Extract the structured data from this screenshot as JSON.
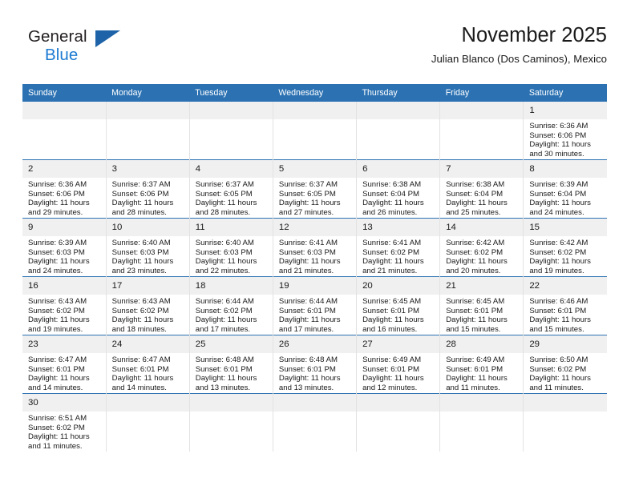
{
  "brand": {
    "word1": "General",
    "word2": "Blue",
    "flag_icon": "triangle-flag-icon",
    "accent_color": "#1e63a8",
    "blue_text_color": "#1b7ad1"
  },
  "header": {
    "month_title": "November 2025",
    "location": "Julian Blanco (Dos Caminos), Mexico"
  },
  "theme": {
    "header_row_bg": "#2c72b3",
    "daynum_bg": "#f0f0f0",
    "cell_bg": "#ffffff",
    "grid_line": "#e2e2e2"
  },
  "calendar": {
    "weekday_headers": [
      "Sunday",
      "Monday",
      "Tuesday",
      "Wednesday",
      "Thursday",
      "Friday",
      "Saturday"
    ],
    "labels": {
      "sunrise": "Sunrise:",
      "sunset": "Sunset:",
      "daylight": "Daylight:"
    },
    "weeks": [
      [
        {
          "day": "",
          "blank": true
        },
        {
          "day": "",
          "blank": true
        },
        {
          "day": "",
          "blank": true
        },
        {
          "day": "",
          "blank": true
        },
        {
          "day": "",
          "blank": true
        },
        {
          "day": "",
          "blank": true
        },
        {
          "day": "1",
          "sunrise": "Sunrise: 6:36 AM",
          "sunset": "Sunset: 6:06 PM",
          "daylight1": "Daylight: 11 hours",
          "daylight2": "and 30 minutes."
        }
      ],
      [
        {
          "day": "2",
          "sunrise": "Sunrise: 6:36 AM",
          "sunset": "Sunset: 6:06 PM",
          "daylight1": "Daylight: 11 hours",
          "daylight2": "and 29 minutes."
        },
        {
          "day": "3",
          "sunrise": "Sunrise: 6:37 AM",
          "sunset": "Sunset: 6:06 PM",
          "daylight1": "Daylight: 11 hours",
          "daylight2": "and 28 minutes."
        },
        {
          "day": "4",
          "sunrise": "Sunrise: 6:37 AM",
          "sunset": "Sunset: 6:05 PM",
          "daylight1": "Daylight: 11 hours",
          "daylight2": "and 28 minutes."
        },
        {
          "day": "5",
          "sunrise": "Sunrise: 6:37 AM",
          "sunset": "Sunset: 6:05 PM",
          "daylight1": "Daylight: 11 hours",
          "daylight2": "and 27 minutes."
        },
        {
          "day": "6",
          "sunrise": "Sunrise: 6:38 AM",
          "sunset": "Sunset: 6:04 PM",
          "daylight1": "Daylight: 11 hours",
          "daylight2": "and 26 minutes."
        },
        {
          "day": "7",
          "sunrise": "Sunrise: 6:38 AM",
          "sunset": "Sunset: 6:04 PM",
          "daylight1": "Daylight: 11 hours",
          "daylight2": "and 25 minutes."
        },
        {
          "day": "8",
          "sunrise": "Sunrise: 6:39 AM",
          "sunset": "Sunset: 6:04 PM",
          "daylight1": "Daylight: 11 hours",
          "daylight2": "and 24 minutes."
        }
      ],
      [
        {
          "day": "9",
          "sunrise": "Sunrise: 6:39 AM",
          "sunset": "Sunset: 6:03 PM",
          "daylight1": "Daylight: 11 hours",
          "daylight2": "and 24 minutes."
        },
        {
          "day": "10",
          "sunrise": "Sunrise: 6:40 AM",
          "sunset": "Sunset: 6:03 PM",
          "daylight1": "Daylight: 11 hours",
          "daylight2": "and 23 minutes."
        },
        {
          "day": "11",
          "sunrise": "Sunrise: 6:40 AM",
          "sunset": "Sunset: 6:03 PM",
          "daylight1": "Daylight: 11 hours",
          "daylight2": "and 22 minutes."
        },
        {
          "day": "12",
          "sunrise": "Sunrise: 6:41 AM",
          "sunset": "Sunset: 6:03 PM",
          "daylight1": "Daylight: 11 hours",
          "daylight2": "and 21 minutes."
        },
        {
          "day": "13",
          "sunrise": "Sunrise: 6:41 AM",
          "sunset": "Sunset: 6:02 PM",
          "daylight1": "Daylight: 11 hours",
          "daylight2": "and 21 minutes."
        },
        {
          "day": "14",
          "sunrise": "Sunrise: 6:42 AM",
          "sunset": "Sunset: 6:02 PM",
          "daylight1": "Daylight: 11 hours",
          "daylight2": "and 20 minutes."
        },
        {
          "day": "15",
          "sunrise": "Sunrise: 6:42 AM",
          "sunset": "Sunset: 6:02 PM",
          "daylight1": "Daylight: 11 hours",
          "daylight2": "and 19 minutes."
        }
      ],
      [
        {
          "day": "16",
          "sunrise": "Sunrise: 6:43 AM",
          "sunset": "Sunset: 6:02 PM",
          "daylight1": "Daylight: 11 hours",
          "daylight2": "and 19 minutes."
        },
        {
          "day": "17",
          "sunrise": "Sunrise: 6:43 AM",
          "sunset": "Sunset: 6:02 PM",
          "daylight1": "Daylight: 11 hours",
          "daylight2": "and 18 minutes."
        },
        {
          "day": "18",
          "sunrise": "Sunrise: 6:44 AM",
          "sunset": "Sunset: 6:02 PM",
          "daylight1": "Daylight: 11 hours",
          "daylight2": "and 17 minutes."
        },
        {
          "day": "19",
          "sunrise": "Sunrise: 6:44 AM",
          "sunset": "Sunset: 6:01 PM",
          "daylight1": "Daylight: 11 hours",
          "daylight2": "and 17 minutes."
        },
        {
          "day": "20",
          "sunrise": "Sunrise: 6:45 AM",
          "sunset": "Sunset: 6:01 PM",
          "daylight1": "Daylight: 11 hours",
          "daylight2": "and 16 minutes."
        },
        {
          "day": "21",
          "sunrise": "Sunrise: 6:45 AM",
          "sunset": "Sunset: 6:01 PM",
          "daylight1": "Daylight: 11 hours",
          "daylight2": "and 15 minutes."
        },
        {
          "day": "22",
          "sunrise": "Sunrise: 6:46 AM",
          "sunset": "Sunset: 6:01 PM",
          "daylight1": "Daylight: 11 hours",
          "daylight2": "and 15 minutes."
        }
      ],
      [
        {
          "day": "23",
          "sunrise": "Sunrise: 6:47 AM",
          "sunset": "Sunset: 6:01 PM",
          "daylight1": "Daylight: 11 hours",
          "daylight2": "and 14 minutes."
        },
        {
          "day": "24",
          "sunrise": "Sunrise: 6:47 AM",
          "sunset": "Sunset: 6:01 PM",
          "daylight1": "Daylight: 11 hours",
          "daylight2": "and 14 minutes."
        },
        {
          "day": "25",
          "sunrise": "Sunrise: 6:48 AM",
          "sunset": "Sunset: 6:01 PM",
          "daylight1": "Daylight: 11 hours",
          "daylight2": "and 13 minutes."
        },
        {
          "day": "26",
          "sunrise": "Sunrise: 6:48 AM",
          "sunset": "Sunset: 6:01 PM",
          "daylight1": "Daylight: 11 hours",
          "daylight2": "and 13 minutes."
        },
        {
          "day": "27",
          "sunrise": "Sunrise: 6:49 AM",
          "sunset": "Sunset: 6:01 PM",
          "daylight1": "Daylight: 11 hours",
          "daylight2": "and 12 minutes."
        },
        {
          "day": "28",
          "sunrise": "Sunrise: 6:49 AM",
          "sunset": "Sunset: 6:01 PM",
          "daylight1": "Daylight: 11 hours",
          "daylight2": "and 11 minutes."
        },
        {
          "day": "29",
          "sunrise": "Sunrise: 6:50 AM",
          "sunset": "Sunset: 6:02 PM",
          "daylight1": "Daylight: 11 hours",
          "daylight2": "and 11 minutes."
        }
      ],
      [
        {
          "day": "30",
          "sunrise": "Sunrise: 6:51 AM",
          "sunset": "Sunset: 6:02 PM",
          "daylight1": "Daylight: 11 hours",
          "daylight2": "and 11 minutes."
        },
        {
          "day": "",
          "blank": true
        },
        {
          "day": "",
          "blank": true
        },
        {
          "day": "",
          "blank": true
        },
        {
          "day": "",
          "blank": true
        },
        {
          "day": "",
          "blank": true
        },
        {
          "day": "",
          "blank": true
        }
      ]
    ]
  }
}
